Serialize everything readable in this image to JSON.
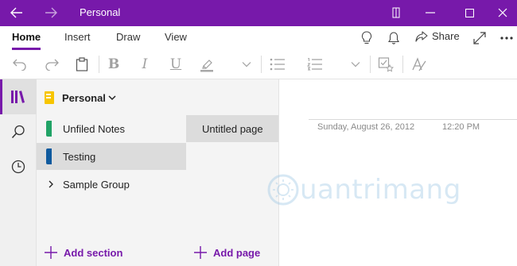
{
  "window": {
    "title": "Personal"
  },
  "ribbon": {
    "tabs": [
      {
        "label": "Home",
        "active": true
      },
      {
        "label": "Insert",
        "active": false
      },
      {
        "label": "Draw",
        "active": false
      },
      {
        "label": "View",
        "active": false
      }
    ],
    "share_label": "Share"
  },
  "toolbar": {
    "icons": [
      "undo-icon",
      "redo-icon",
      "paste-icon",
      "bold-icon",
      "italic-icon",
      "underline-icon",
      "highlight-icon",
      "font-dropdown-icon",
      "bullets-icon",
      "numbering-icon",
      "list-dropdown-icon",
      "todo-tag-icon",
      "styles-icon"
    ],
    "bold": "B",
    "italic": "I",
    "underline": "U"
  },
  "notebook": {
    "name": "Personal",
    "color": "#f7c500"
  },
  "sections": [
    {
      "label": "Unfiled Notes",
      "color": "#21a366",
      "selected": false
    },
    {
      "label": "Testing",
      "color": "#0f5a9e",
      "selected": true
    },
    {
      "label": "Sample Group",
      "type": "group"
    }
  ],
  "add_section_label": "Add section",
  "pages": [
    {
      "label": "Untitled page",
      "selected": true
    }
  ],
  "add_page_label": "Add page",
  "page": {
    "date": "Sunday, August 26, 2012",
    "time": "12:20 PM"
  },
  "watermark": "uantrimang",
  "colors": {
    "accent": "#7719aa",
    "pane_bg": "#f4f4f4",
    "selected_bg": "#dcdcdc"
  }
}
